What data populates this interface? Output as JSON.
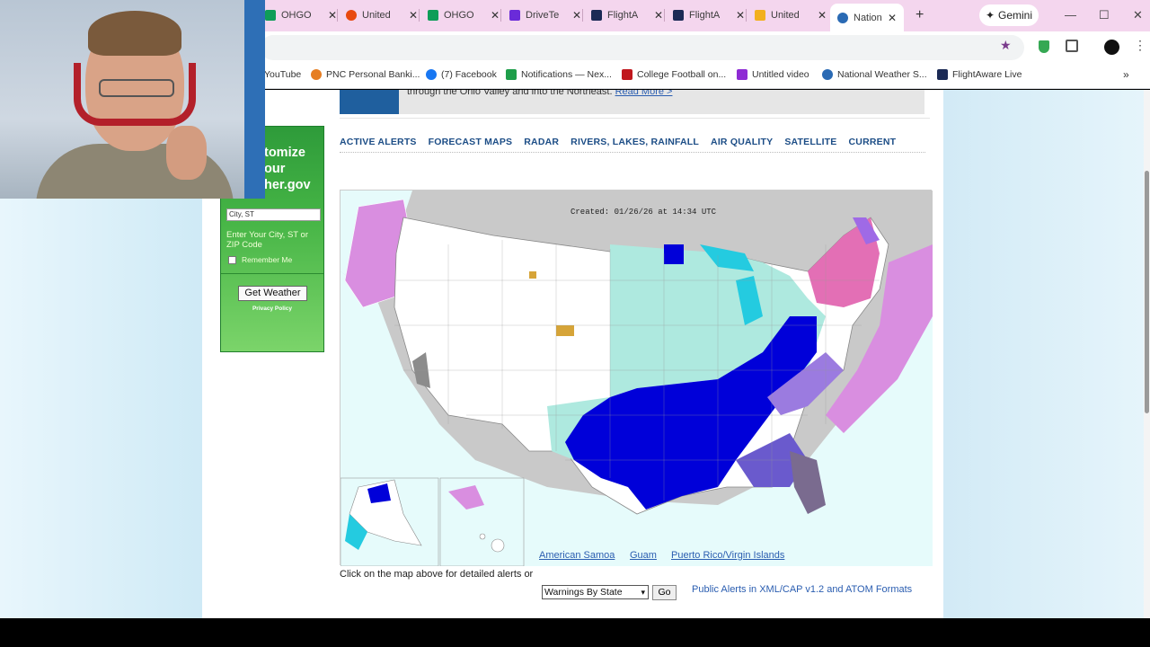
{
  "browser": {
    "tabs": [
      {
        "label": "OHGO",
        "color": "#0f9d58"
      },
      {
        "label": "United",
        "color": "#e8490f"
      },
      {
        "label": "OHGO",
        "color": "#0f9d58"
      },
      {
        "label": "DriveTe",
        "color": "#6a2bd9"
      },
      {
        "label": "FlightA",
        "color": "#1b2a55"
      },
      {
        "label": "FlightA",
        "color": "#1b2a55"
      },
      {
        "label": "United",
        "color": "#f2b01e"
      },
      {
        "label": "Nation",
        "color": "#2a6ab4"
      }
    ],
    "gemini_label": "Gemini",
    "bookmarks": [
      {
        "label": "YouTube"
      },
      {
        "label": "PNC Personal Banki..."
      },
      {
        "label": "(7) Facebook"
      },
      {
        "label": "Notifications — Nex..."
      },
      {
        "label": "College Football on..."
      },
      {
        "label": "Untitled video"
      },
      {
        "label": "National Weather S..."
      },
      {
        "label": "FlightAware Live"
      }
    ]
  },
  "page": {
    "banner_text": "through the Ohio Valley and into the Northeast.",
    "banner_link": "Read More >",
    "nav": [
      "ACTIVE ALERTS",
      "FORECAST MAPS",
      "RADAR",
      "RIVERS, LAKES, RAINFALL",
      "AIR QUALITY",
      "SATELLITE",
      "CURRENT"
    ],
    "widget": {
      "title": "tomize\nour\nher.gov",
      "input_value": "City, ST",
      "hint": "Enter Your City, ST or ZIP Code",
      "remember_label": "Remember Me",
      "button_label": "Get Weather",
      "privacy": "Privacy Policy"
    },
    "map": {
      "created_text": "Created: 01/26/26 at 14:34 UTC",
      "links": [
        "American Samoa",
        "Guam",
        "Puerto Rico/Virgin Islands"
      ]
    },
    "click_text": "Click on the map above for detailed alerts or",
    "select_value": "Warnings By State",
    "go_label": "Go",
    "cap_link": "Public Alerts in XML/CAP v1.2 and ATOM Formats"
  }
}
